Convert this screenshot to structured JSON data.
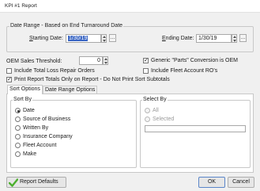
{
  "window": {
    "title": "KPI #1 Report"
  },
  "date_range": {
    "group_label": "Date Range - Based on End Turnaround Date",
    "starting_label": "Starting Date:",
    "starting_value": "1/30/19",
    "ending_label": "Ending Date:",
    "ending_value": "1/30/19",
    "ellipsis": "..."
  },
  "options": {
    "oem_threshold_label": "OEM Sales Threshold:",
    "oem_threshold_value": "0",
    "generic_parts_label": "Generic \"Parts\" Conversion is OEM",
    "generic_parts_checked": true,
    "total_loss_label": "Include Total Loss Repair Orders",
    "total_loss_checked": false,
    "fleet_ro_label": "Include Fleet Account RO's",
    "fleet_ro_checked": false,
    "print_totals_label": "Print Report Totals Only on Report - Do Not Print Sort Subtotals",
    "print_totals_checked": true
  },
  "tabs": [
    {
      "label": "Sort Options",
      "active": true
    },
    {
      "label": "Date Range Options",
      "active": false
    }
  ],
  "sort_by": {
    "group_label": "Sort By",
    "items": [
      {
        "label": "Date",
        "selected": true
      },
      {
        "label": "Source of Business",
        "selected": false
      },
      {
        "label": "Written By",
        "selected": false
      },
      {
        "label": "Insurance Company",
        "selected": false
      },
      {
        "label": "Fleet Account",
        "selected": false
      },
      {
        "label": "Make",
        "selected": false
      }
    ]
  },
  "select_by": {
    "group_label": "Select By",
    "all_label": "All",
    "selected_label": "Selected",
    "selected_value": ""
  },
  "footer": {
    "defaults_label": "Report Defaults",
    "ok_label": "OK",
    "cancel_label": "Cancel"
  },
  "colors": {
    "selection": "#3a66c4",
    "checkmark_green": "#4caf2e"
  },
  "icons": {
    "defaults": "green-checkmark-icon"
  }
}
